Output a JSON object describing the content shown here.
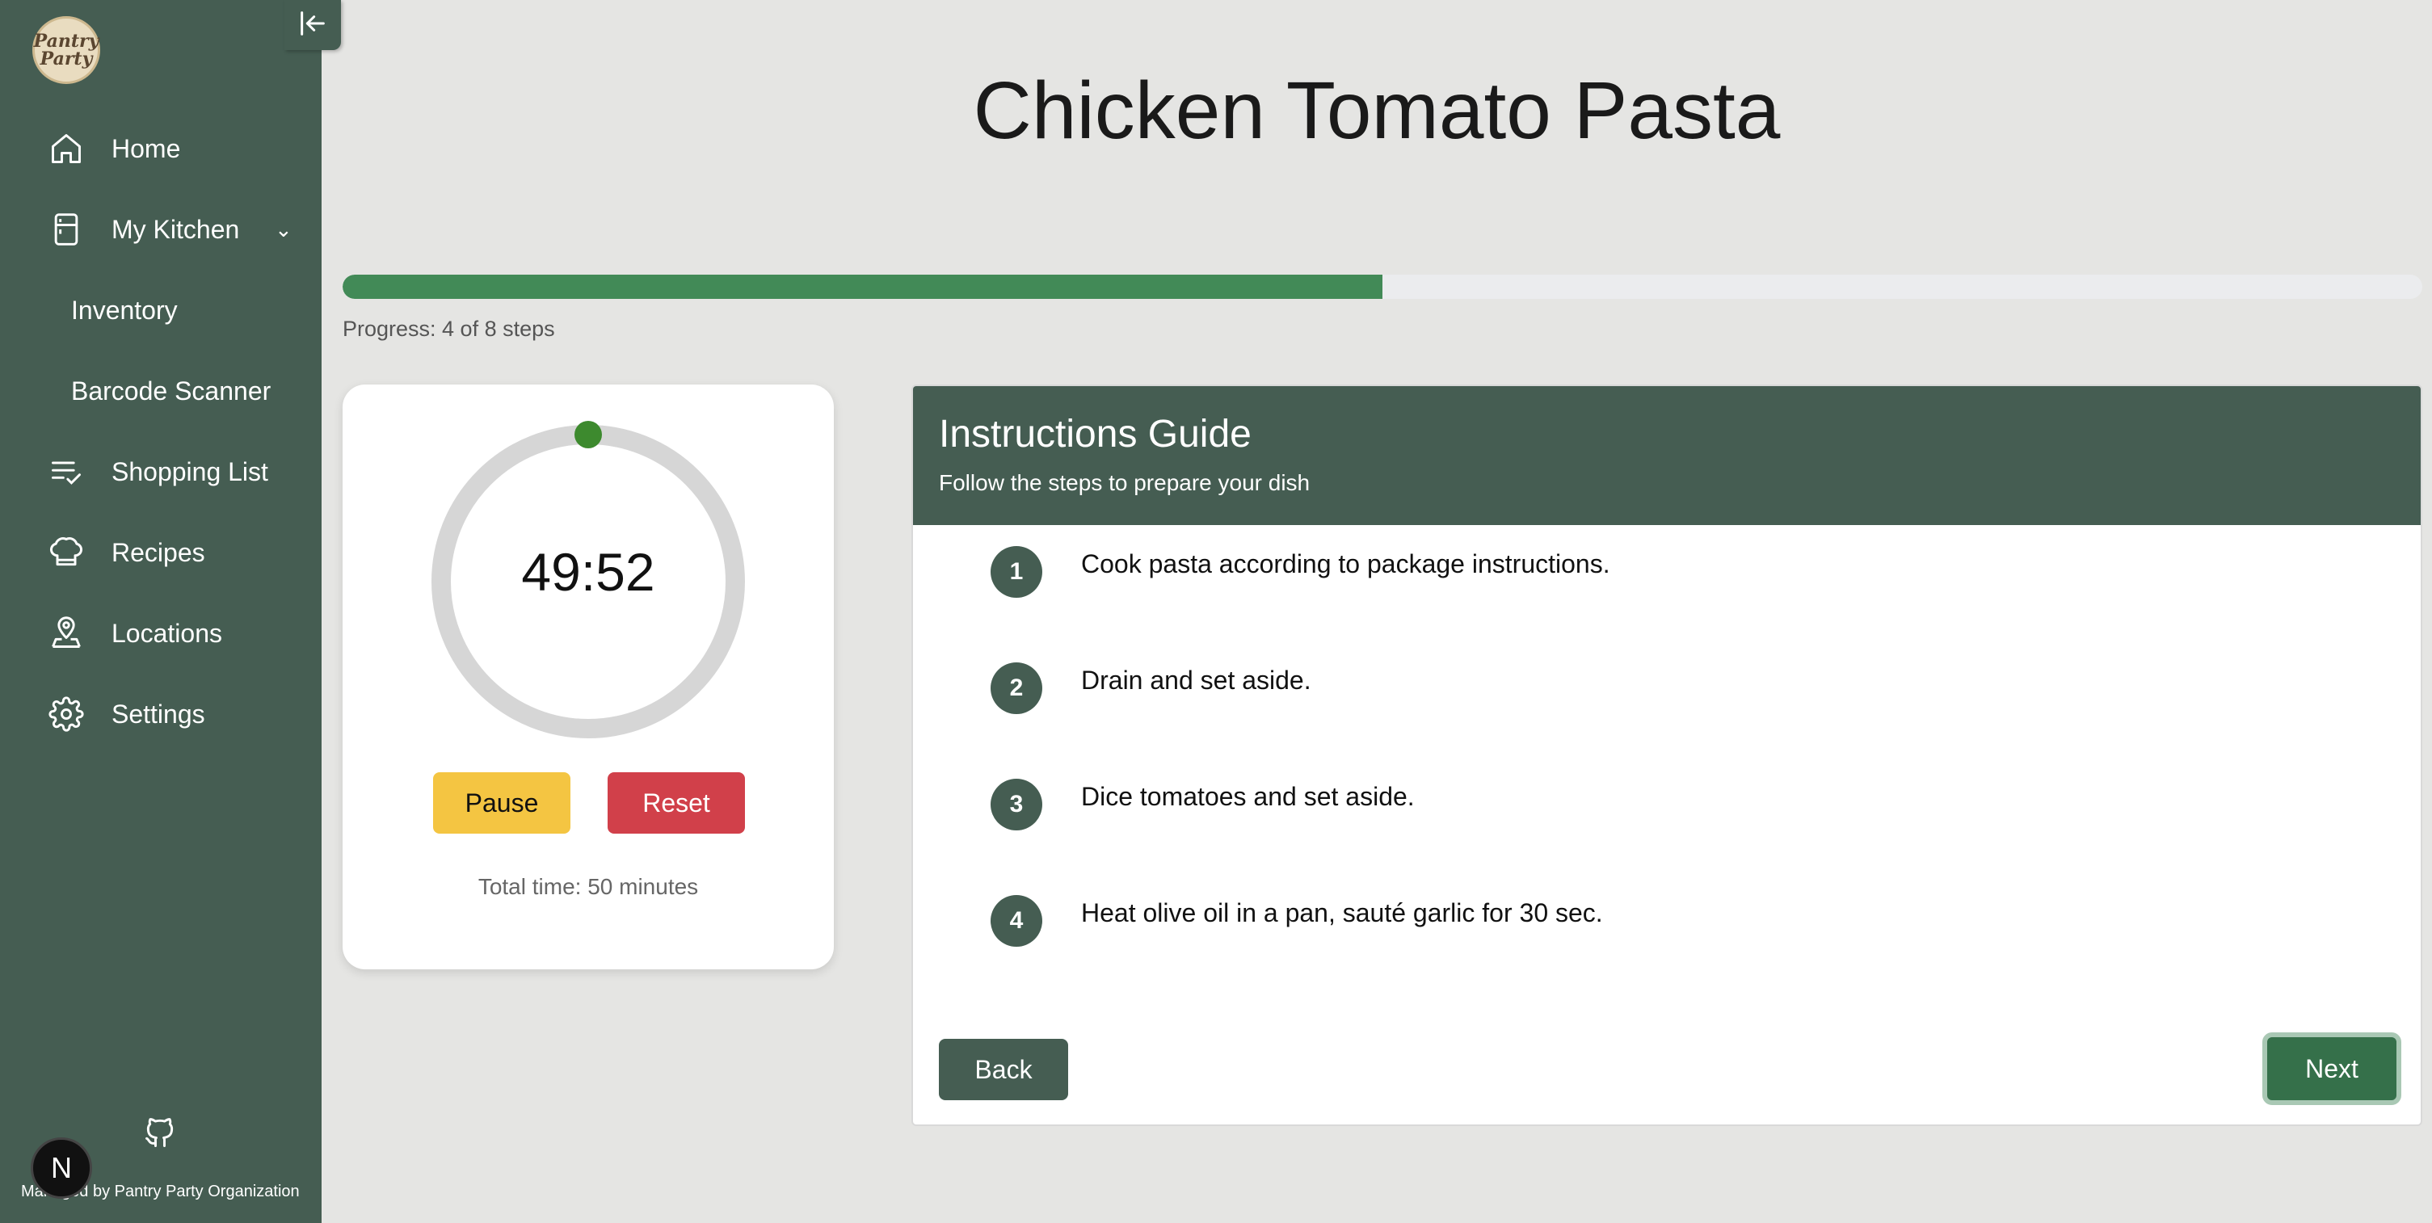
{
  "app": {
    "logo_text": "Pantry Party"
  },
  "sidebar": {
    "items": [
      {
        "label": "Home",
        "icon": "home-icon"
      },
      {
        "label": "My Kitchen",
        "icon": "fridge-icon"
      },
      {
        "label": "Inventory"
      },
      {
        "label": "Barcode Scanner"
      },
      {
        "label": "Shopping List",
        "icon": "checklist-icon"
      },
      {
        "label": "Recipes",
        "icon": "chef-hat-icon"
      },
      {
        "label": "Locations",
        "icon": "location-user-icon"
      },
      {
        "label": "Settings",
        "icon": "gear-icon"
      }
    ],
    "footer": "Managed by Pantry Party Organization",
    "badge": "N",
    "color": "#455d52"
  },
  "page": {
    "title": "Chicken Tomato Pasta"
  },
  "progress": {
    "text": "Progress: 4 of 8 steps",
    "current": 4,
    "total": 8,
    "fraction": 0.5,
    "color": "#428a57"
  },
  "timer": {
    "value": "49:52",
    "pause_label": "Pause",
    "reset_label": "Reset",
    "total_text": "Total time: 50 minutes"
  },
  "instructions": {
    "title": "Instructions Guide",
    "subtitle": "Follow the steps to prepare your dish",
    "steps": [
      {
        "num": "1",
        "text": "Cook pasta according to package instructions."
      },
      {
        "num": "2",
        "text": "Drain and set aside."
      },
      {
        "num": "3",
        "text": "Dice tomatoes and set aside."
      },
      {
        "num": "4",
        "text": "Heat olive oil in a pan, sauté garlic for 30 sec."
      }
    ],
    "back_label": "Back",
    "next_label": "Next"
  }
}
